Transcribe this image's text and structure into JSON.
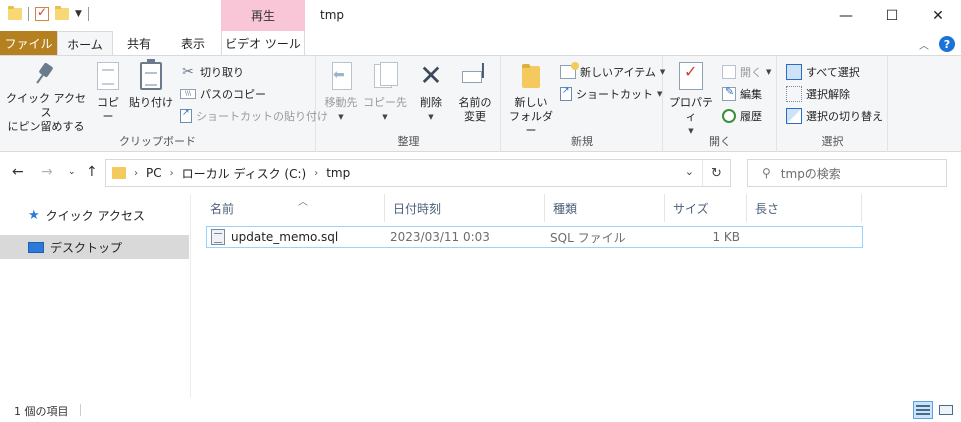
{
  "window": {
    "title": "tmp",
    "context_tab_group": "再生",
    "controls": {
      "minimize": "—",
      "maximize": "☐",
      "close": "✕"
    }
  },
  "ribbon_tabs": [
    {
      "label": "ファイル"
    },
    {
      "label": "ホーム"
    },
    {
      "label": "共有"
    },
    {
      "label": "表示"
    },
    {
      "label": "ビデオ ツール"
    }
  ],
  "ribbon": {
    "clipboard": {
      "group_label": "クリップボード",
      "pin_quick_access_line1": "クイック アクセス",
      "pin_quick_access_line2": "にピン留めする",
      "copy": "コピー",
      "paste": "貼り付け",
      "cut": "切り取り",
      "copy_path": "パスのコピー",
      "paste_shortcut": "ショートカットの貼り付け"
    },
    "organize": {
      "group_label": "整理",
      "move_to": "移動先",
      "copy_to": "コピー先",
      "delete": "削除",
      "rename_line1": "名前の",
      "rename_line2": "変更"
    },
    "new": {
      "group_label": "新規",
      "new_folder_line1": "新しい",
      "new_folder_line2": "フォルダー",
      "new_item": "新しいアイテム",
      "easy_access": "ショートカット"
    },
    "open": {
      "group_label": "開く",
      "properties": "プロパティ",
      "open": "開く",
      "edit": "編集",
      "history": "履歴"
    },
    "select": {
      "group_label": "選択",
      "select_all": "すべて選択",
      "select_none": "選択解除",
      "invert_selection": "選択の切り替え"
    }
  },
  "address": {
    "crumbs": [
      "PC",
      "ローカル ディスク (C:)",
      "tmp"
    ],
    "search_placeholder": "tmpの検索"
  },
  "nav_pane": {
    "items": [
      {
        "label": "クイック アクセス",
        "icon": "star-icon"
      },
      {
        "label": "デスクトップ",
        "icon": "desktop-icon",
        "selected": true
      }
    ]
  },
  "file_list": {
    "columns": [
      "名前",
      "日付時刻",
      "種類",
      "サイズ",
      "長さ"
    ],
    "rows": [
      {
        "name": "update_memo.sql",
        "date": "2023/03/11 0:03",
        "type": "SQL ファイル",
        "size": "1 KB",
        "length": ""
      }
    ]
  },
  "status_bar": {
    "item_count": "1 個の項目"
  },
  "colors": {
    "file_tab": "#b5801f",
    "context_tab": "#f8c6d6",
    "accent": "#2b79d8",
    "selection_border": "#99d1ff"
  }
}
